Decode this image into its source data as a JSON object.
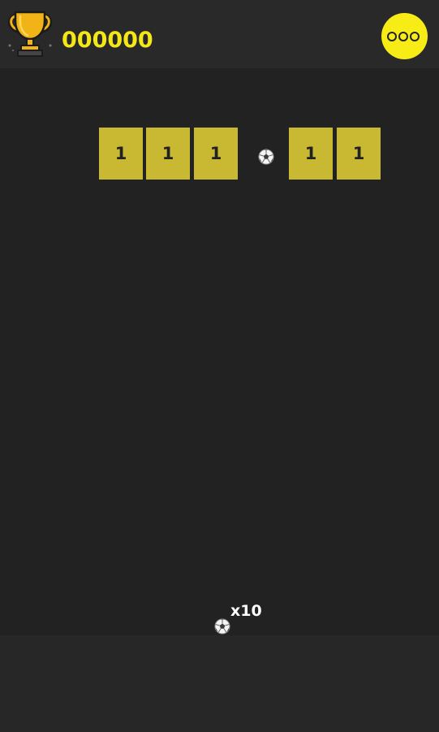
{
  "header": {
    "score": "000000",
    "trophy_icon": "trophy-icon",
    "menu_icon": "more-options-icon"
  },
  "bricks": [
    "1",
    "1",
    "1",
    "1",
    "1"
  ],
  "ball": {
    "icon": "soccer-ball-icon",
    "count_label": "x10"
  },
  "colors": {
    "accent": "#f7ec15",
    "brick": "#c9b832",
    "background": "#222222",
    "header": "#292929"
  }
}
